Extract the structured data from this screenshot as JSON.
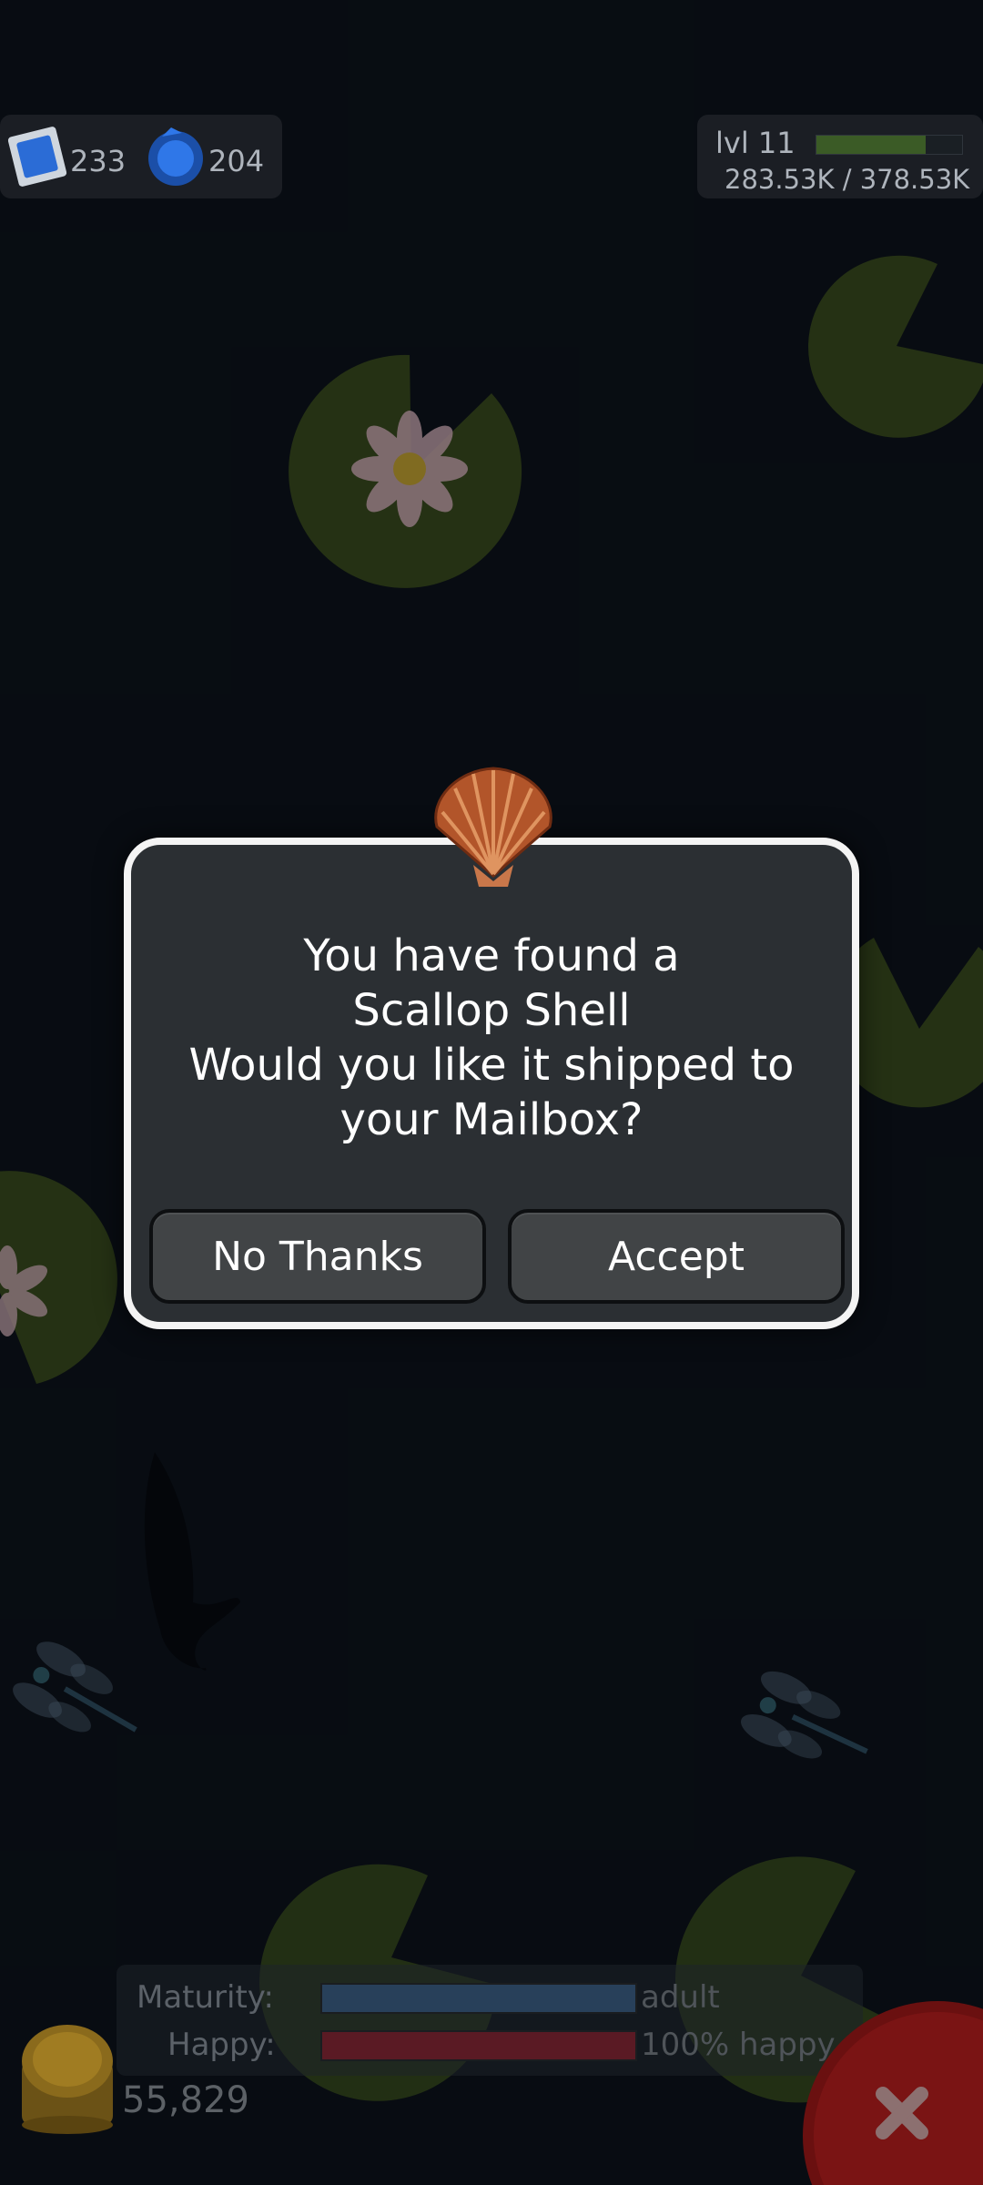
{
  "hud": {
    "stamps": "233",
    "gems": "204",
    "level": "lvl 11",
    "xp": "283.53K / 378.53K",
    "xp_progress": 0.75
  },
  "dialog": {
    "line1": "You have found a",
    "line2": "Scallop Shell",
    "line3": "Would you like it shipped to",
    "line4": "your Mailbox?",
    "decline_label": "No Thanks",
    "accept_label": "Accept",
    "item_icon": "scallop-shell-icon"
  },
  "status": {
    "maturity_label": "Maturity:",
    "maturity_value": "adult",
    "happy_label": "Happy:",
    "happy_value": "100% happy",
    "coins": "55,829"
  },
  "icons": [
    "stamp-icon",
    "gem-icon",
    "coin-stack-icon",
    "close-icon",
    "lily-pad-icon",
    "lotus-flower-icon",
    "koi-fish-icon",
    "dragonfly-icon"
  ],
  "colors": {
    "water": "#0c121a",
    "dialog_bg": "#2b2f33",
    "dialog_border": "#f4f4f4",
    "button_bg": "#414446",
    "xp_bar": "#3b5b26",
    "maturity_bar": "#28405a",
    "happy_bar": "#5a1a24",
    "close_button": "#7a1212"
  }
}
